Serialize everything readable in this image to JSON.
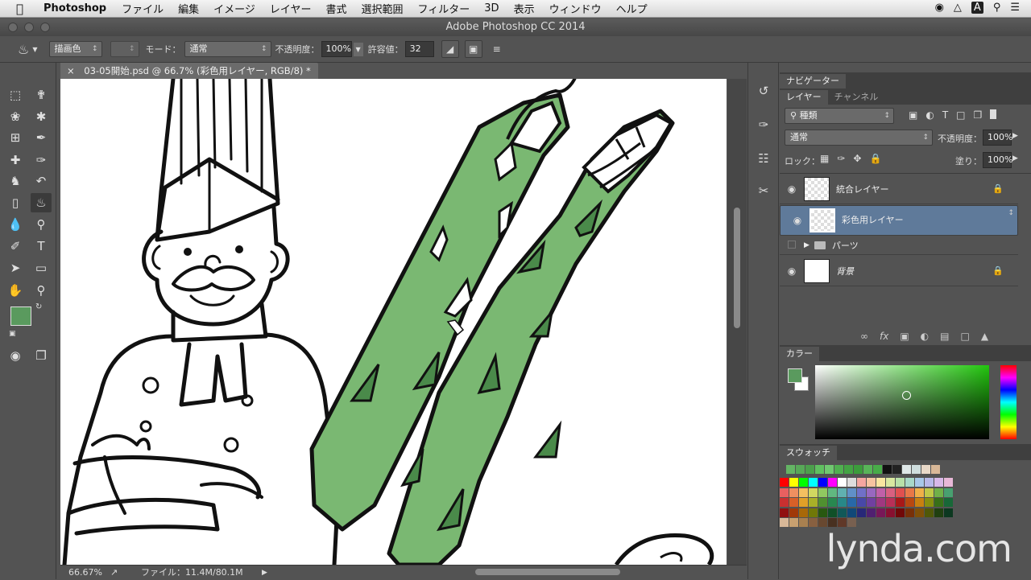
{
  "menubar": {
    "app_name": "Photoshop",
    "items": [
      "ファイル",
      "編集",
      "イメージ",
      "レイヤー",
      "書式",
      "選択範囲",
      "フィルター",
      "3D",
      "表示",
      "ウィンドウ",
      "ヘルプ"
    ]
  },
  "window_title": "Adobe Photoshop CC 2014",
  "options_bar": {
    "fill_source": "描画色",
    "mode_label": "モード：",
    "mode_value": "通常",
    "opacity_label": "不透明度：",
    "opacity_value": "100%",
    "tolerance_label": "許容値：",
    "tolerance_value": "32"
  },
  "document": {
    "tab_title": "03-05開始.psd @ 66.7% (彩色用レイヤー, RGB/8) *",
    "close_glyph": "×"
  },
  "status": {
    "zoom": "66.67%",
    "file_info": "ファイル：11.4M/80.1M"
  },
  "colors": {
    "foreground": "#5a9a5e",
    "background": "#ffffff",
    "asparagus_fill": "#7ab872",
    "asparagus_dark": "#4a8a4a",
    "layer_selected": "#5f7a9a"
  },
  "navigator_panel": {
    "tab": "ナビゲーター"
  },
  "layers_panel": {
    "tabs": [
      "レイヤー",
      "チャンネル"
    ],
    "filter_kind": "種類",
    "blend_mode": "通常",
    "opacity_label": "不透明度：",
    "opacity_value": "100%",
    "lock_label": "ロック：",
    "fill_label": "塗り：",
    "fill_value": "100%",
    "layers": [
      {
        "name": "統合レイヤー",
        "visible": true,
        "locked": true,
        "selected": false,
        "type": "pixel"
      },
      {
        "name": "彩色用レイヤー",
        "visible": true,
        "locked": false,
        "selected": true,
        "type": "pixel"
      },
      {
        "name": "パーツ",
        "visible": false,
        "locked": false,
        "selected": false,
        "type": "group"
      },
      {
        "name": "背景",
        "visible": true,
        "locked": true,
        "selected": false,
        "type": "background"
      }
    ]
  },
  "color_panel": {
    "tab": "カラー"
  },
  "swatches_panel": {
    "tab": "スウォッチ"
  },
  "watermark": "lynda.com"
}
